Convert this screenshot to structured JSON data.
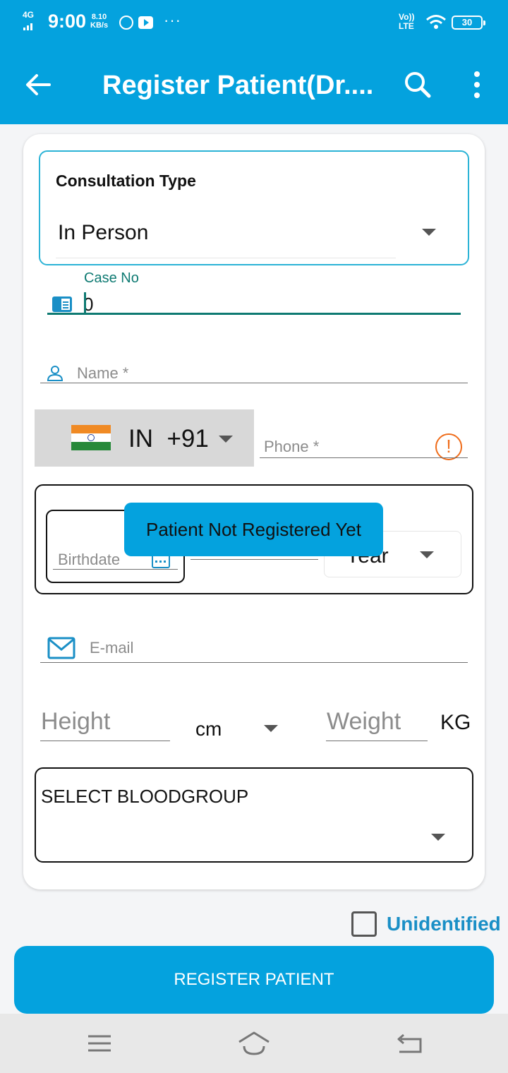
{
  "status_bar": {
    "network": "4G",
    "time": "9:00",
    "speed_value": "8.10",
    "speed_unit": "KB/s",
    "more": "···",
    "volte_top": "Vo))",
    "volte_bottom": "LTE",
    "battery": "30"
  },
  "app_bar": {
    "title": "Register Patient(Dr...."
  },
  "form": {
    "consultation_type_label": "Consultation Type",
    "consultation_type_value": "In Person",
    "case_no_label": "Case No",
    "case_no_value": "0",
    "name_placeholder": "Name *",
    "country_code": "IN",
    "dial_code": "+91",
    "phone_placeholder": "Phone *",
    "birthdate_placeholder": "Birthdate",
    "age_unit": "Year",
    "email_placeholder": "E-mail",
    "height_placeholder": "Height",
    "height_unit": "cm",
    "weight_placeholder": "Weight",
    "weight_unit": "KG",
    "bloodgroup_label": "SELECT BLOODGROUP",
    "unidentified_label": "Unidentified"
  },
  "toast": {
    "message": "Patient Not Registered Yet"
  },
  "register_button": "REGISTER PATIENT",
  "colors": {
    "primary": "#04a2de",
    "accent_teal": "#0e7a72",
    "warning": "#ef6c1a",
    "link_blue": "#1a8fc6"
  }
}
